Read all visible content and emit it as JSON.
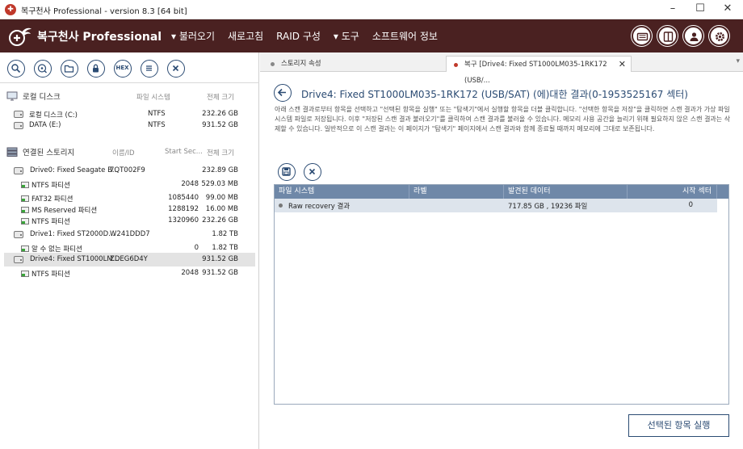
{
  "window": {
    "title": "복구천사 Professional - version 8.3 [64 bit]",
    "app_icon_letter": "✚",
    "minimize": "–",
    "maximize": "☐",
    "close": "✕"
  },
  "header": {
    "logo_text": "복구천사 Professional",
    "menu": [
      "▾ 불러오기",
      "새로고침",
      "RAID 구성",
      "▾ 도구",
      "소프트웨어 정보"
    ],
    "colors": {
      "band": "#4a2121",
      "accent": "#2b4b73"
    }
  },
  "left": {
    "local_section": {
      "label": "로컬 디스크",
      "col_fs": "파일 시스템",
      "col_size": "전체 크기",
      "rows": [
        {
          "name": "로컬 디스크 (C:)",
          "fs": "NTFS",
          "size": "232.26 GB"
        },
        {
          "name": "DATA (E:)",
          "fs": "NTFS",
          "size": "931.52 GB"
        }
      ]
    },
    "connected_section": {
      "label": "연결된 스토리지",
      "col_name": "이름/ID",
      "col_start": "Start Sec...",
      "col_size": "전체 크기",
      "rows": [
        {
          "type": "drive",
          "name": "Drive0: Fixed Seagate B...",
          "id": "7QT002F9",
          "start": "",
          "size": "232.89 GB"
        },
        {
          "type": "part",
          "name": "NTFS 파티션",
          "id": "",
          "start": "2048",
          "size": "529.03 MB"
        },
        {
          "type": "part",
          "name": "FAT32 파티션",
          "id": "",
          "start": "1085440",
          "size": "99.00 MB"
        },
        {
          "type": "part",
          "name": "MS Reserved 파티션",
          "id": "",
          "start": "1288192",
          "size": "16.00 MB"
        },
        {
          "type": "part",
          "name": "NTFS 파티션",
          "id": "",
          "start": "1320960",
          "size": "232.26 GB"
        },
        {
          "type": "drive",
          "name": "Drive1: Fixed ST2000D...",
          "id": "W241DDD7",
          "start": "",
          "size": "1.82 TB"
        },
        {
          "type": "part",
          "name": "알 수 없는 파티션",
          "id": "",
          "start": "0",
          "size": "1.82 TB"
        },
        {
          "type": "drive",
          "name": "Drive4: Fixed ST1000LM...",
          "id": "ZDEG6D4Y",
          "start": "",
          "size": "931.52 GB",
          "selected": true
        },
        {
          "type": "part",
          "name": "NTFS 파티션",
          "id": "",
          "start": "2048",
          "size": "931.52 GB"
        }
      ]
    }
  },
  "right": {
    "tabs": [
      {
        "label": "스토리지 속성",
        "dot_color": "#888888"
      },
      {
        "label": "복구 [Drive4: Fixed ST1000LM035-1RK172 (USB/...",
        "dot_color": "#c0392b",
        "close": "✕"
      }
    ],
    "tab_menu": "▾",
    "title": "Drive4: Fixed ST1000LM035-1RK172 (USB/SAT) (에)대한 결과(0-1953525167 섹터)",
    "description": "아래 스캔 결과로부터 항목을 선택하고 \"선택된 항목을 실행\" 또는 \"탐색기\"에서 실행할 항목을 더블 클릭합니다. \"선택한 항목을 저장\"을 클릭하면 스캔 결과가 가상 파일 시스템 파일로 저장됩니다. 이후 \"저장된 스캔 결과 불러오기\"를 클릭하여 스캔 결과를 불러올 수 있습니다. 메모리 사용 공간을 늘리기 위해 필요하지 않은 스캔 결과는 삭제할 수 있습니다. 일반적으로 이 스캔 결과는 이 페이지가 \"탐색기\" 페이지에서 스캔 결과와 함께 종료될 때까지 메모리에 그대로 보존됩니다.",
    "table": {
      "headers": [
        "파일 시스템",
        "라벨",
        "발견된 데이터",
        "시작 섹터"
      ],
      "rows": [
        {
          "fs": "Raw recovery 결과",
          "label": "",
          "found": "717.85 GB , 19236 파일",
          "start": "0"
        }
      ]
    },
    "run_button": "선택된 항목 실행"
  }
}
